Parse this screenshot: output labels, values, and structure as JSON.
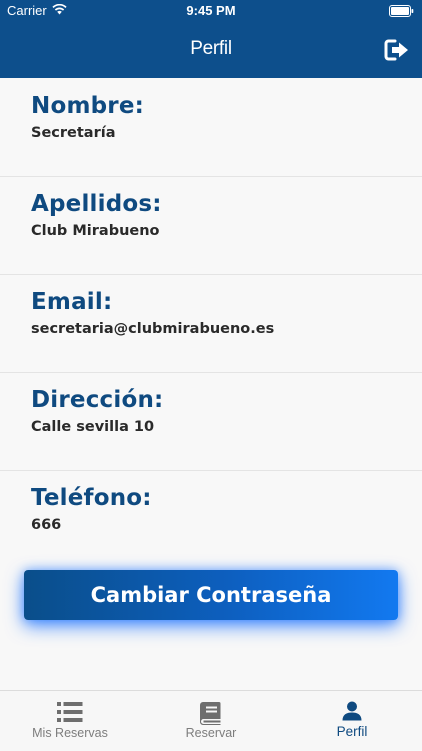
{
  "status_bar": {
    "carrier": "Carrier",
    "time": "9:45 PM"
  },
  "nav": {
    "title": "Perfil",
    "logout_icon": "sign-out-icon"
  },
  "profile": {
    "fields": [
      {
        "label": "Nombre:",
        "value": "Secretaría"
      },
      {
        "label": "Apellidos:",
        "value": "Club Mirabueno"
      },
      {
        "label": "Email:",
        "value": "secretaria@clubmirabueno.es"
      },
      {
        "label": "Dirección:",
        "value": "Calle sevilla 10"
      },
      {
        "label": "Teléfono:",
        "value": "666"
      }
    ],
    "change_password_label": "Cambiar Contraseña"
  },
  "tab_bar": {
    "tabs": [
      {
        "label": "Mis Reservas",
        "icon": "list-icon",
        "active": false
      },
      {
        "label": "Reservar",
        "icon": "book-icon",
        "active": false
      },
      {
        "label": "Perfil",
        "icon": "user-icon",
        "active": true
      }
    ]
  },
  "colors": {
    "primary": "#0d4f8c",
    "label": "#0f4a80",
    "button_gradient_end": "#1279f0",
    "tab_inactive": "#7d7d7d"
  }
}
